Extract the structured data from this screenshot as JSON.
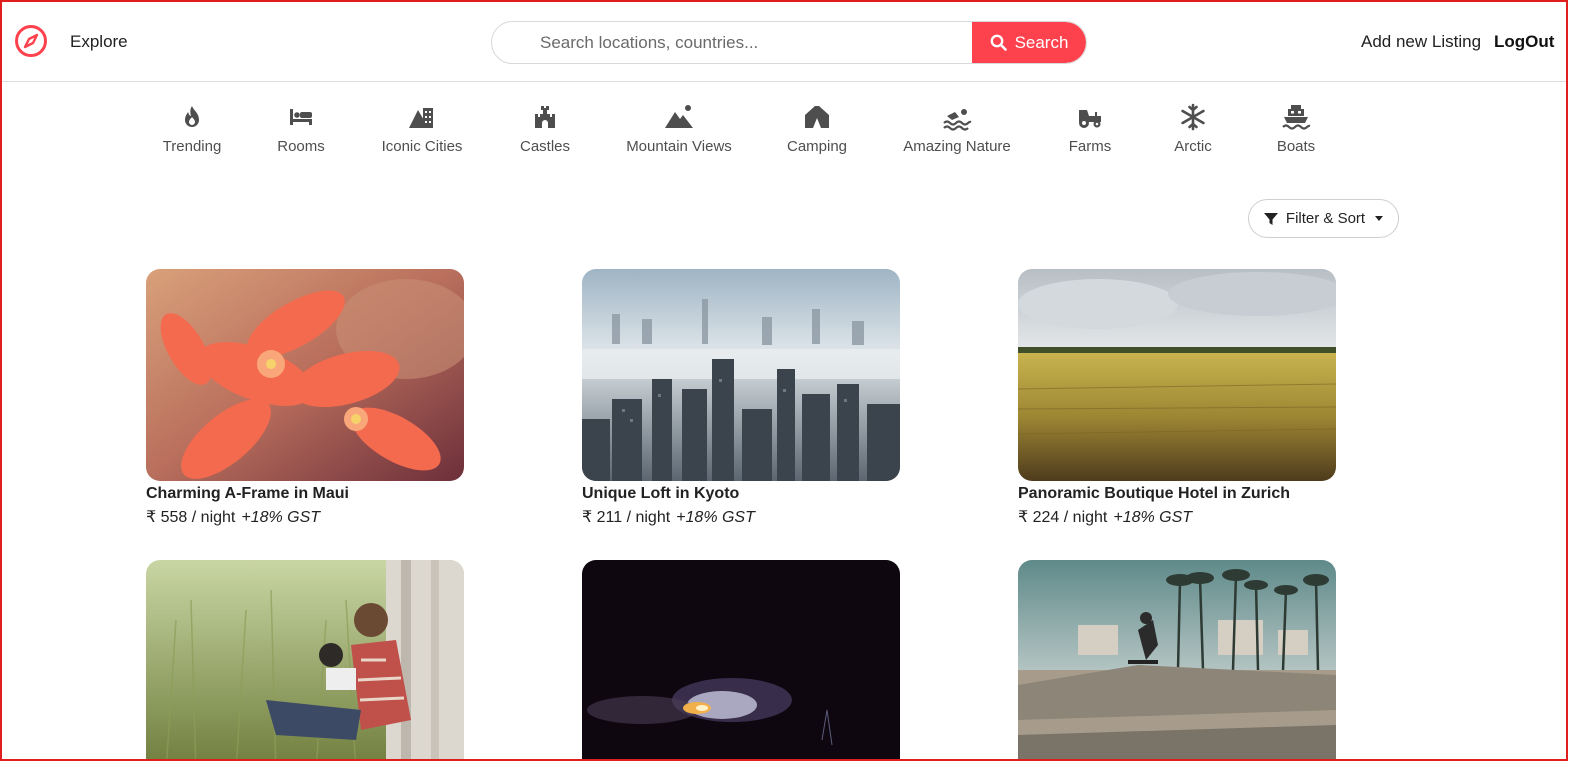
{
  "navbar": {
    "explore": "Explore",
    "search_placeholder": "Search locations, countries...",
    "search_button": "Search",
    "add_listing": "Add new Listing",
    "logout": "LogOut"
  },
  "filters": [
    {
      "label": "Trending",
      "icon": "fire-icon"
    },
    {
      "label": "Rooms",
      "icon": "bed-icon"
    },
    {
      "label": "Iconic Cities",
      "icon": "city-icon"
    },
    {
      "label": "Castles",
      "icon": "castle-icon"
    },
    {
      "label": "Mountain Views",
      "icon": "mountain-icon"
    },
    {
      "label": "Camping",
      "icon": "tent-icon"
    },
    {
      "label": "Amazing Nature",
      "icon": "swimmer-icon"
    },
    {
      "label": "Farms",
      "icon": "tractor-icon"
    },
    {
      "label": "Arctic",
      "icon": "snowflake-icon"
    },
    {
      "label": "Boats",
      "icon": "ship-icon"
    }
  ],
  "filter_sort": "Filter & Sort",
  "listings": [
    {
      "title": "Charming A-Frame in Maui",
      "price": "₹ 558",
      "per": " / night",
      "gst": "+18% GST"
    },
    {
      "title": "Unique Loft in Kyoto",
      "price": "₹ 211",
      "per": " / night",
      "gst": "+18% GST"
    },
    {
      "title": "Panoramic Boutique Hotel in Zurich",
      "price": "₹ 224",
      "per": " / night",
      "gst": "+18% GST"
    },
    {
      "title": "",
      "price": "",
      "per": "",
      "gst": ""
    },
    {
      "title": "",
      "price": "",
      "per": "",
      "gst": ""
    },
    {
      "title": "",
      "price": "",
      "per": "",
      "gst": ""
    }
  ],
  "colors": {
    "brand": "#fe424d",
    "text": "#222222",
    "border": "#dddddd"
  }
}
